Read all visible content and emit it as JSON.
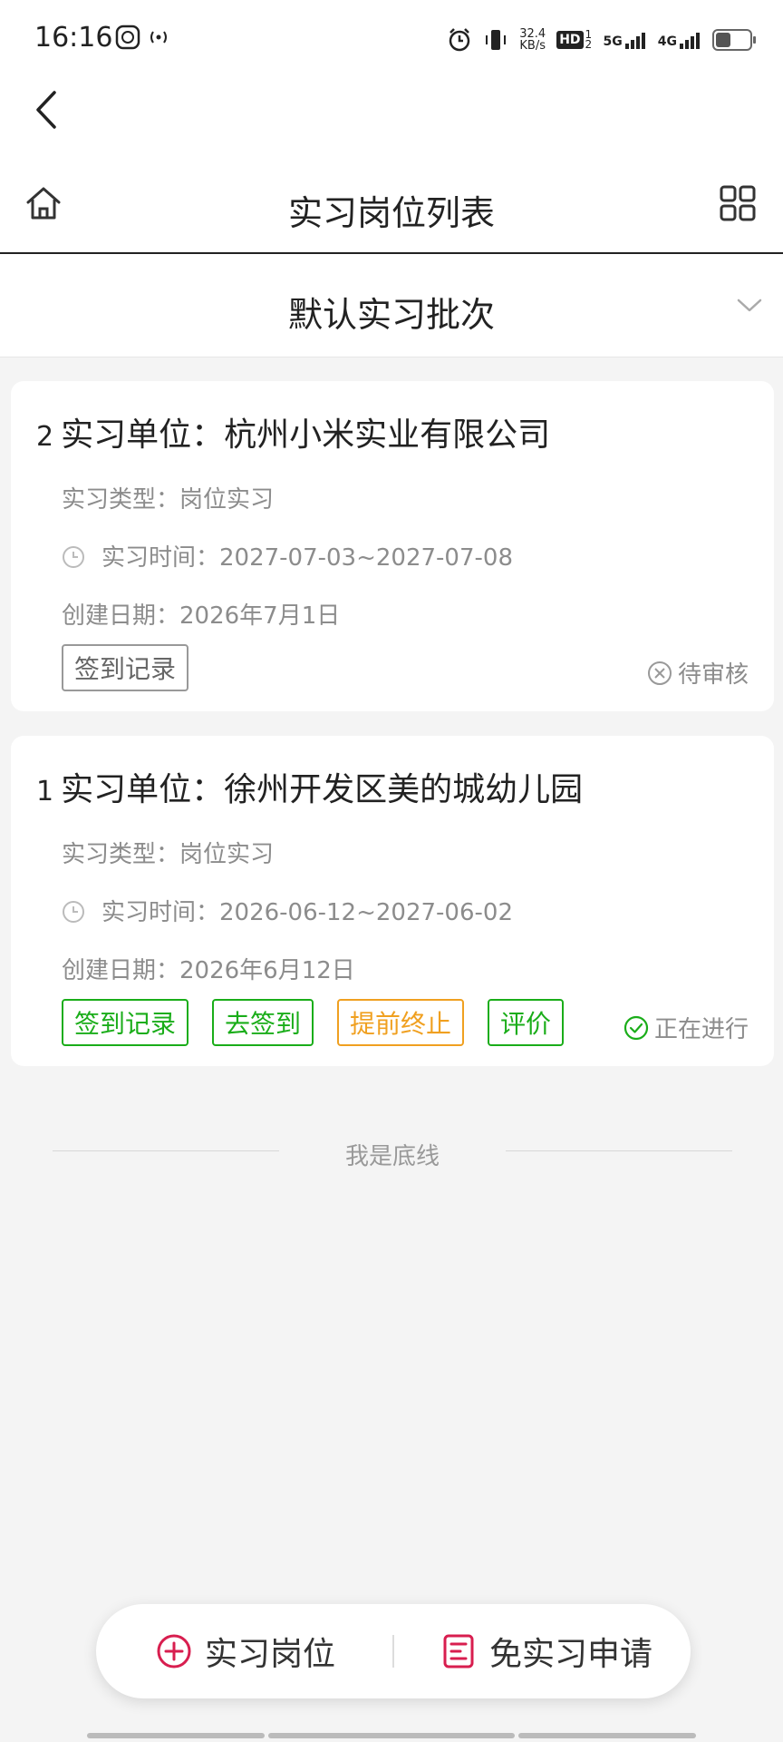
{
  "status_bar": {
    "time": "16:16",
    "net_speed_value": "32.4",
    "net_speed_unit": "KB/s",
    "hd_label": "HD",
    "hd_sub": "12",
    "net_5g": "5G",
    "net_4g": "4G"
  },
  "header": {
    "title": "实习岗位列表"
  },
  "batch_selector": {
    "label": "默认实习批次"
  },
  "cards": [
    {
      "index": "2",
      "unit": "实习单位：杭州小米实业有限公司",
      "type": "实习类型：岗位实习",
      "time": "实习时间：2027-07-03~2027-07-08",
      "created": "创建日期：2026年7月1日",
      "buttons": [
        "签到记录"
      ],
      "status": "待审核"
    },
    {
      "index": "1",
      "unit": "实习单位：徐州开发区美的城幼儿园",
      "type": "实习类型：岗位实习",
      "time": "实习时间：2026-06-12~2027-06-02",
      "created": "创建日期：2026年6月12日",
      "buttons": [
        "签到记录",
        "去签到",
        "提前终止",
        "评价"
      ],
      "status": "正在进行"
    }
  ],
  "list_end": "我是底线",
  "bottom_bar": {
    "left_label": "实习岗位",
    "right_label": "免实习申请"
  },
  "colors": {
    "green": "#1aad19",
    "orange": "#f0a020",
    "accent_red": "#d81e4f",
    "gray_text": "#8c8c8c"
  }
}
